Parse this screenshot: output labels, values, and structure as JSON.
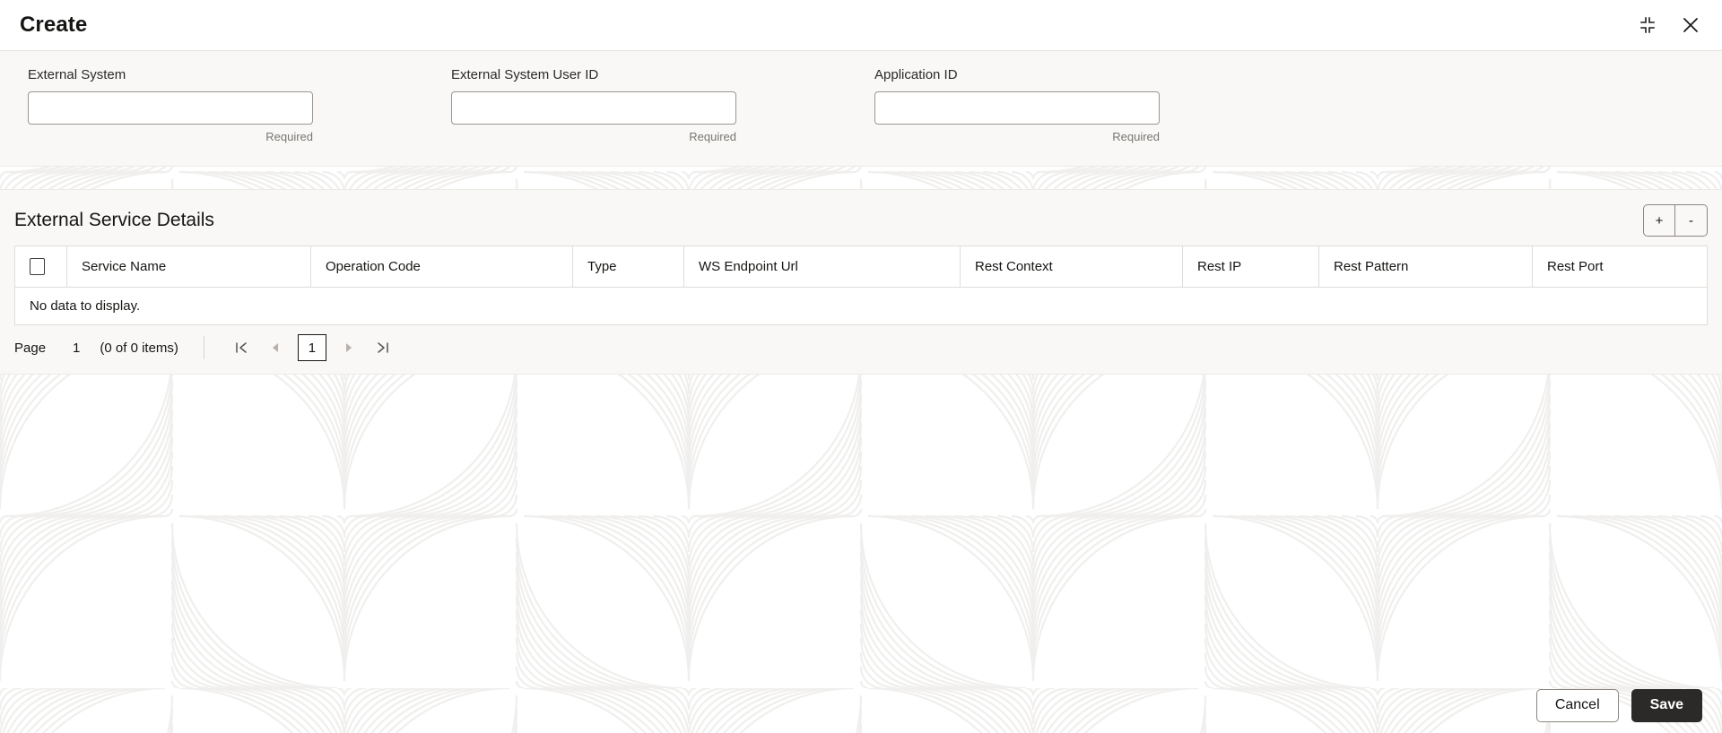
{
  "window": {
    "title": "Create",
    "collapse_icon": "collapse-icon",
    "close_icon": "close-icon"
  },
  "form": {
    "fields": [
      {
        "label": "External System",
        "value": "",
        "placeholder": "",
        "hint": "Required"
      },
      {
        "label": "External System User ID",
        "value": "",
        "placeholder": "",
        "hint": "Required"
      },
      {
        "label": "Application ID",
        "value": "",
        "placeholder": "",
        "hint": "Required"
      }
    ]
  },
  "details": {
    "title": "External Service Details",
    "add_label": "+",
    "remove_label": "-",
    "columns": [
      "Service Name",
      "Operation Code",
      "Type",
      "WS Endpoint Url",
      "Rest Context",
      "Rest IP",
      "Rest Pattern",
      "Rest Port"
    ],
    "rows": [],
    "empty_message": "No data to display."
  },
  "pager": {
    "page_label": "Page",
    "page_value": "1",
    "items_text": "(0 of 0 items)",
    "first_icon": "first-page-icon",
    "prev_icon": "previous-page-icon",
    "current_page": "1",
    "next_icon": "next-page-icon",
    "last_icon": "last-page-icon"
  },
  "footer": {
    "cancel_label": "Cancel",
    "save_label": "Save"
  },
  "colors": {
    "panel_bg": "#f9f8f7",
    "page_bg": "#ffffff",
    "text": "#161513",
    "muted_text": "#7a756f",
    "border": "#e0ddd9",
    "input_border": "#9a958f",
    "primary_button_bg": "#2b2a28",
    "watermark": "#f1f0ee"
  }
}
